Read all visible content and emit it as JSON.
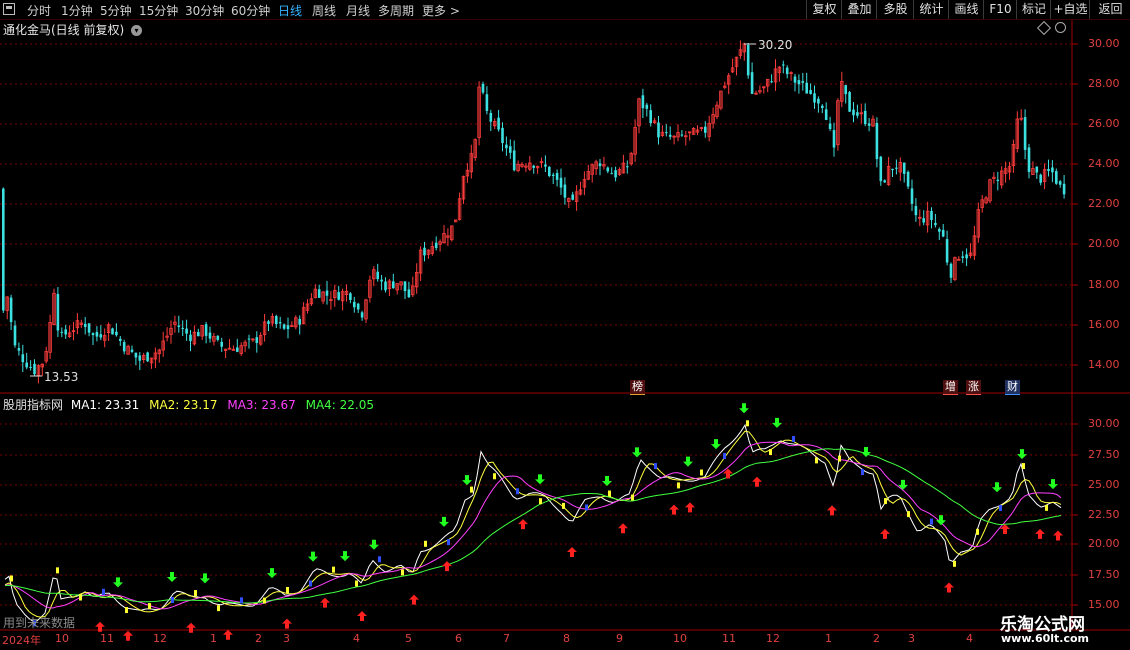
{
  "toolbar": {
    "window_icon": "window-icon",
    "timeframes": [
      {
        "label": "分时",
        "active": false
      },
      {
        "label": "1分钟",
        "active": false
      },
      {
        "label": "5分钟",
        "active": false
      },
      {
        "label": "15分钟",
        "active": false
      },
      {
        "label": "30分钟",
        "active": false
      },
      {
        "label": "60分钟",
        "active": false
      },
      {
        "label": "日线",
        "active": true
      },
      {
        "label": "周线",
        "active": false
      },
      {
        "label": "月线",
        "active": false
      },
      {
        "label": "多周期",
        "active": false
      },
      {
        "label": "更多 >",
        "active": false
      }
    ],
    "right_buttons": [
      "复权",
      "叠加",
      "多股",
      "统计",
      "画线",
      "F10",
      "标记",
      "+自选",
      "返回"
    ]
  },
  "main_chart": {
    "title": "通化金马(日线 前复权)",
    "max_label": "30.20",
    "min_label": "13.53",
    "y_ticks": [
      "30.00",
      "28.00",
      "26.00",
      "24.00",
      "22.00",
      "20.00",
      "18.00",
      "16.00",
      "14.00"
    ],
    "badges": [
      {
        "text": "榜",
        "color": "#e0a030"
      },
      {
        "text": "增",
        "color": "#ff5050"
      },
      {
        "text": "涨",
        "color": "#ff5050"
      },
      {
        "text": "财",
        "color": "#4090ff"
      }
    ]
  },
  "indicator": {
    "name": "股朋指标网",
    "ma1": {
      "label": "MA1: 23.31",
      "color": "#ffffff"
    },
    "ma2": {
      "label": "MA2: 23.17",
      "color": "#ffff40"
    },
    "ma3": {
      "label": "MA3: 23.67",
      "color": "#ff40ff"
    },
    "ma4": {
      "label": "MA4: 22.05",
      "color": "#40ff40"
    },
    "y_ticks": [
      "30.00",
      "27.50",
      "25.00",
      "22.50",
      "20.00",
      "17.50",
      "15.00"
    ],
    "bottom_hint": "用到未来数据"
  },
  "x_axis": {
    "labels": [
      "2024年",
      "10",
      "11",
      "12",
      "1",
      "2",
      "3",
      "4",
      "5",
      "6",
      "7",
      "8",
      "9",
      "10",
      "11",
      "12",
      "1",
      "2",
      "3",
      "4"
    ]
  },
  "watermark": {
    "title": "乐淘公式网",
    "url": "www.60lt.com"
  },
  "colors": {
    "up": "#ff3c3c",
    "down": "#3ce0e0",
    "grid": "#7a0000",
    "active_tab": "#34b4ff"
  }
}
